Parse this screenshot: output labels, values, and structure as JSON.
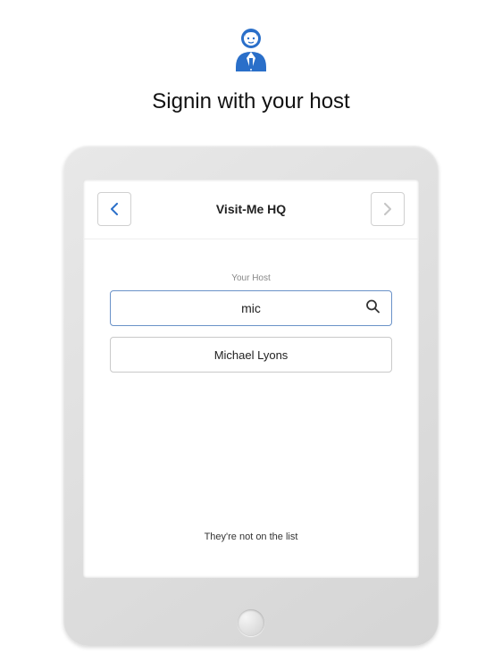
{
  "page": {
    "heading": "Signin with your host"
  },
  "screen": {
    "title": "Visit-Me HQ",
    "host_label": "Your Host",
    "search_value": "mic",
    "result_name": "Michael Lyons",
    "not_on_list": "They're not on the list"
  },
  "colors": {
    "accent": "#2a6fc9",
    "nav_disabled": "#c5c5c5"
  }
}
